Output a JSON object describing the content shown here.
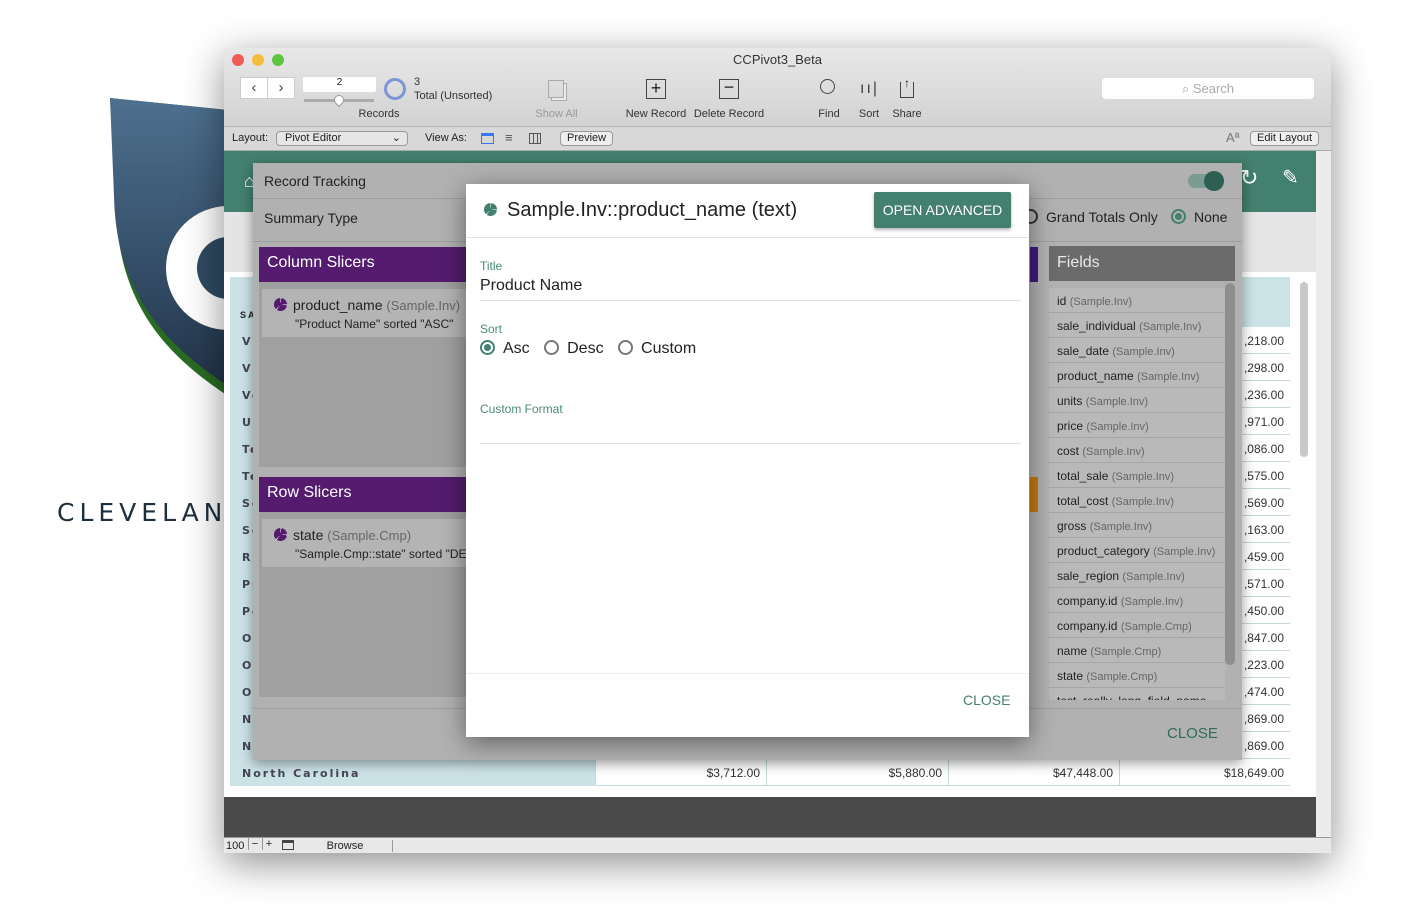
{
  "background": {
    "logo_text": "CLEVELAN"
  },
  "window": {
    "title": "CCPivot3_Beta"
  },
  "toolbar": {
    "record_number": "2",
    "records_label": "Records",
    "total_count": "3",
    "total_label": "Total (Unsorted)",
    "show_all": "Show All",
    "new_record": "New Record",
    "delete_record": "Delete Record",
    "find": "Find",
    "sort": "Sort",
    "share": "Share",
    "search_placeholder": "Search"
  },
  "layoutbar": {
    "layout_label": "Layout:",
    "layout_value": "Pivot Editor",
    "view_as_label": "View As:",
    "preview": "Preview",
    "font_icon": "Aª",
    "edit_layout": "Edit Layout"
  },
  "table": {
    "header_fragment": "SA",
    "rows": [
      {
        "label": "Vi",
        "last": ",218.00"
      },
      {
        "label": "Vi",
        "last": ",298.00"
      },
      {
        "label": "Ve",
        "last": ",236.00"
      },
      {
        "label": "Ut",
        "last": ",971.00"
      },
      {
        "label": "Te",
        "last": ",086.00"
      },
      {
        "label": "Te",
        "last": ",575.00"
      },
      {
        "label": "So",
        "last": ",569.00"
      },
      {
        "label": "So",
        "last": ",163.00"
      },
      {
        "label": "Rh",
        "last": ",459.00"
      },
      {
        "label": "Pu",
        "last": ",571.00"
      },
      {
        "label": "Pe",
        "last": ",450.00"
      },
      {
        "label": "Or",
        "last": ",847.00"
      },
      {
        "label": "Ok",
        "last": ",223.00"
      },
      {
        "label": "Oh",
        "last": ",474.00"
      },
      {
        "label": "No",
        "last": ",869.00"
      },
      {
        "label": "No",
        "last": ",869.00"
      }
    ],
    "last_row": {
      "label": "North Carolina",
      "values": [
        "$3,712.00",
        "$5,880.00",
        "$47,448.00",
        "$18,649.00"
      ]
    }
  },
  "statusbar": {
    "zoom": "100",
    "mode": "Browse"
  },
  "panel": {
    "record_tracking": "Record Tracking",
    "summary_type": "Summary Type",
    "grand_totals_only": "Grand Totals Only",
    "none": "None",
    "summary_selected": "None",
    "column_slicers": {
      "title": "Column Slicers",
      "items": [
        {
          "field": "product_name",
          "table": "(Sample.Inv)",
          "desc": "\"Product Name\" sorted \"ASC\""
        }
      ]
    },
    "row_slicers": {
      "title": "Row Slicers",
      "items": [
        {
          "field": "state",
          "table": "(Sample.Cmp)",
          "desc": "\"Sample.Cmp::state\" sorted \"DE"
        }
      ]
    },
    "fields": {
      "title": "Fields",
      "items": [
        {
          "name": "id",
          "table": "(Sample.Inv)"
        },
        {
          "name": "sale_individual",
          "table": "(Sample.Inv)"
        },
        {
          "name": "sale_date",
          "table": "(Sample.Inv)"
        },
        {
          "name": "product_name",
          "table": "(Sample.Inv)"
        },
        {
          "name": "units",
          "table": "(Sample.Inv)"
        },
        {
          "name": "price",
          "table": "(Sample.Inv)"
        },
        {
          "name": "cost",
          "table": "(Sample.Inv)"
        },
        {
          "name": "total_sale",
          "table": "(Sample.Inv)"
        },
        {
          "name": "total_cost",
          "table": "(Sample.Inv)"
        },
        {
          "name": "gross",
          "table": "(Sample.Inv)"
        },
        {
          "name": "product_category",
          "table": "(Sample.Inv)"
        },
        {
          "name": "sale_region",
          "table": "(Sample.Inv)"
        },
        {
          "name": "company.id",
          "table": "(Sample.Inv)"
        },
        {
          "name": "company.id",
          "table": "(Sample.Cmp)"
        },
        {
          "name": "name",
          "table": "(Sample.Cmp)"
        },
        {
          "name": "state",
          "table": "(Sample.Cmp)"
        },
        {
          "name": "test_really_long_field_name",
          "table": ""
        }
      ]
    },
    "close": "CLOSE"
  },
  "modal": {
    "title": "Sample.Inv::product_name (text)",
    "open_advanced": "OPEN ADVANCED",
    "title_label": "Title",
    "title_value": "Product Name",
    "sort_label": "Sort",
    "sort_options": [
      "Asc",
      "Desc",
      "Custom"
    ],
    "sort_selected": "Asc",
    "custom_format_label": "Custom Format",
    "custom_format_value": "",
    "close": "CLOSE"
  },
  "colors": {
    "teal": "#44806f",
    "purple": "#541b6e",
    "orange": "#c57a10",
    "fields_header": "#6b6b6b"
  }
}
